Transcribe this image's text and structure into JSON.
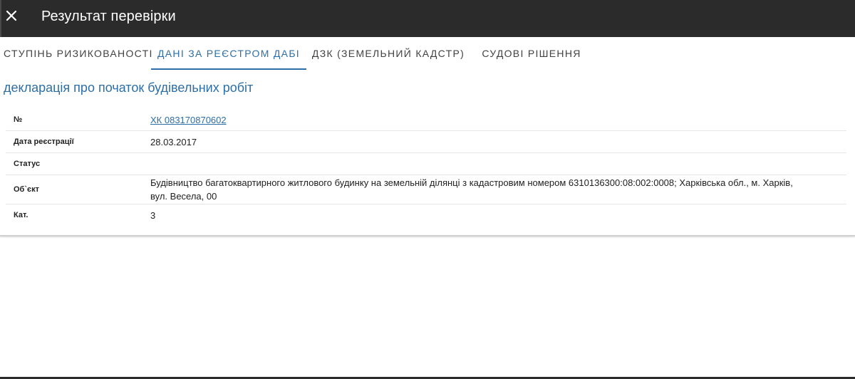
{
  "header": {
    "title": "Результат перевірки",
    "close_icon": "close-icon"
  },
  "tabs": [
    {
      "label": "СТУПІНЬ РИЗИКОВАНОСТІ",
      "active": false
    },
    {
      "label": "ДАНІ ЗА РЕЄСТРОМ ДАБІ",
      "active": true
    },
    {
      "label": "ДЗК (ЗЕМЕЛЬНИЙ КАДСТР)",
      "active": false
    },
    {
      "label": "СУДОВІ РІШЕННЯ",
      "active": false
    }
  ],
  "section": {
    "title": "декларація про початок будівельних робіт"
  },
  "details": {
    "rows": [
      {
        "label": "№",
        "value": "ХК 083170870602"
      },
      {
        "label": "Дата реєстрації",
        "value": "28.03.2017"
      },
      {
        "label": "Статус",
        "value": ""
      },
      {
        "label": "Об`єкт",
        "value_line1": "Будівництво багатоквартирного житлового будинку на земельній ділянці з кадастровим номером 6310136300:08:002:0008; Харківська обл., м. Харків,",
        "value_line2": "вул. Весела, 00"
      },
      {
        "label": "Кат.",
        "value": "3"
      }
    ]
  },
  "colors": {
    "header_bg": "#2b2b2b",
    "accent": "#2e6ea6"
  }
}
